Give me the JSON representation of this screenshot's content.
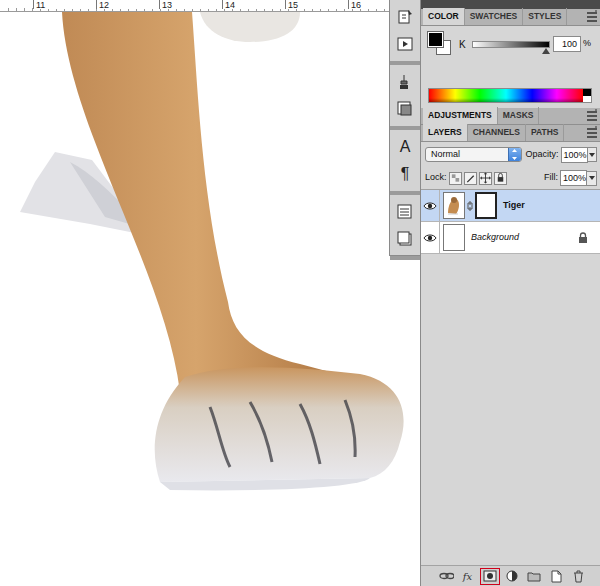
{
  "ruler": {
    "ticks": [
      "11",
      "12",
      "13",
      "14",
      "15",
      "16"
    ]
  },
  "dock": {
    "groups": [
      [
        {
          "kind": "history"
        },
        {
          "kind": "actions"
        }
      ],
      [
        {
          "kind": "clone"
        },
        {
          "kind": "presets"
        }
      ],
      [
        {
          "kind": "character",
          "glyph": "A"
        },
        {
          "kind": "paragraph",
          "glyph": "¶"
        }
      ],
      [
        {
          "kind": "comps"
        },
        {
          "kind": "notes"
        }
      ]
    ]
  },
  "color_panel": {
    "tabs": [
      {
        "label": "COLOR",
        "selected": true
      },
      {
        "label": "SWATCHES",
        "selected": false
      },
      {
        "label": "STYLES",
        "selected": false
      }
    ],
    "channel": {
      "label": "K",
      "level": 0.96,
      "value": "100",
      "unit": "%"
    }
  },
  "adjustments_panel": {
    "tabs": [
      {
        "label": "ADJUSTMENTS",
        "selected": true
      },
      {
        "label": "MASKS",
        "selected": false
      }
    ]
  },
  "layers_panel": {
    "tabs": [
      {
        "label": "LAYERS",
        "selected": true
      },
      {
        "label": "CHANNELS",
        "selected": false
      },
      {
        "label": "PATHS",
        "selected": false
      }
    ],
    "blend_mode": "Normal",
    "opacity": {
      "label": "Opacity:",
      "value": "100%"
    },
    "lock": {
      "label": "Lock:"
    },
    "fill": {
      "label": "Fill:",
      "value": "100%"
    },
    "layers": [
      {
        "name": "Tiger",
        "kind": "layer",
        "selected": true,
        "visible": true,
        "has_mask": true,
        "locked": false
      },
      {
        "name": "Background",
        "kind": "background",
        "selected": false,
        "visible": true,
        "has_mask": false,
        "locked": true
      }
    ],
    "bottom_buttons": [
      {
        "kind": "link",
        "highlighted": false
      },
      {
        "kind": "fx",
        "label": "fx",
        "highlighted": false
      },
      {
        "kind": "mask",
        "highlighted": true
      },
      {
        "kind": "adjustment",
        "highlighted": false
      },
      {
        "kind": "group",
        "highlighted": false
      },
      {
        "kind": "new",
        "highlighted": false
      },
      {
        "kind": "delete",
        "highlighted": false
      }
    ]
  }
}
